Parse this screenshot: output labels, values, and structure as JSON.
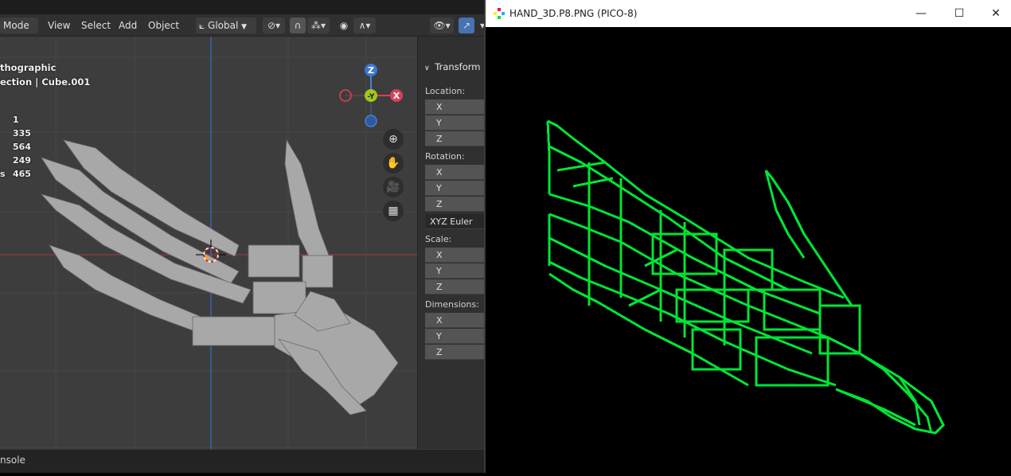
{
  "blender": {
    "header": {
      "mode_label": "Mode",
      "menu_view": "View",
      "menu_select": "Select",
      "menu_add": "Add",
      "menu_object": "Object",
      "orientation_label": "Global"
    },
    "overlay": {
      "view_name": "thographic",
      "collection_line": "ection | Cube.001",
      "stats": [
        {
          "label": "",
          "value": "1"
        },
        {
          "label": "",
          "value": "335"
        },
        {
          "label": "",
          "value": "564"
        },
        {
          "label": "",
          "value": "249"
        },
        {
          "label": "s",
          "value": "465"
        }
      ]
    },
    "gizmo": {
      "z": "Z",
      "y": "-Y",
      "x": "X"
    },
    "npanel": {
      "section_title": "Transform",
      "location_label": "Location:",
      "rotation_label": "Rotation:",
      "rotation_mode": "XYZ Euler",
      "scale_label": "Scale:",
      "dimensions_label": "Dimensions:",
      "axes": [
        "X",
        "Y",
        "Z"
      ]
    },
    "statusbar": {
      "console_label": "nsole"
    }
  },
  "pico": {
    "window_title": "HAND_3D.P8.PNG (PICO-8)",
    "accent_color": "#00e436"
  },
  "colors": {
    "blender_bg": "#393939",
    "grid_axis_red": "#a03a3a",
    "grid_axis_blue": "#3a6ec8",
    "pico_green": "#00e436"
  }
}
